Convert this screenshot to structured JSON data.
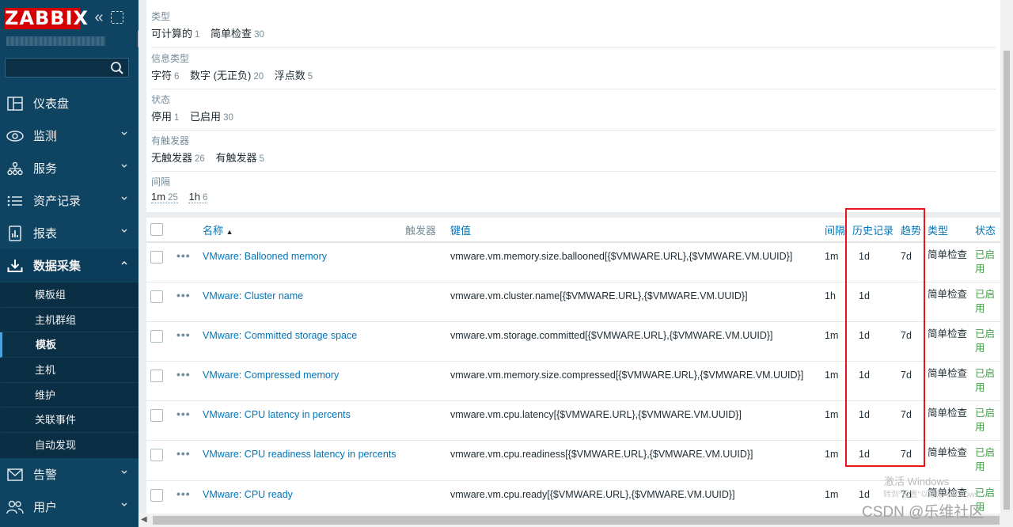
{
  "app": {
    "logo_text": "ZABBIX",
    "search_placeholder": ""
  },
  "sidebar": {
    "items": [
      {
        "label": "仪表盘",
        "icon": "dashboard-icon"
      },
      {
        "label": "监测",
        "icon": "eye-icon"
      },
      {
        "label": "服务",
        "icon": "services-icon"
      },
      {
        "label": "资产记录",
        "icon": "list-icon"
      },
      {
        "label": "报表",
        "icon": "report-icon"
      },
      {
        "label": "数据采集",
        "icon": "download-icon"
      },
      {
        "label": "告警",
        "icon": "mail-icon"
      },
      {
        "label": "用户",
        "icon": "users-icon"
      }
    ],
    "submenu": [
      "模板组",
      "主机群组",
      "模板",
      "主机",
      "维护",
      "关联事件",
      "自动发现"
    ],
    "active_submenu": "模板"
  },
  "filters": [
    {
      "title": "类型",
      "values": [
        {
          "label": "可计算的",
          "count": "1"
        },
        {
          "label": "简单检查",
          "count": "30"
        }
      ]
    },
    {
      "title": "信息类型",
      "values": [
        {
          "label": "字符",
          "count": "6"
        },
        {
          "label": "数字 (无正负)",
          "count": "20"
        },
        {
          "label": "浮点数",
          "count": "5"
        }
      ]
    },
    {
      "title": "状态",
      "values": [
        {
          "label": "停用",
          "count": "1"
        },
        {
          "label": "已启用",
          "count": "30"
        }
      ]
    },
    {
      "title": "有触发器",
      "values": [
        {
          "label": "无触发器",
          "count": "26"
        },
        {
          "label": "有触发器",
          "count": "5"
        }
      ]
    },
    {
      "title": "间隔",
      "values": [
        {
          "label": "1m",
          "count": "25"
        },
        {
          "label": "1h",
          "count": "6"
        }
      ]
    }
  ],
  "table": {
    "headers": {
      "name": "名称",
      "triggers": "触发器",
      "key": "键值",
      "interval": "间隔",
      "history": "历史记录",
      "trends": "趋势",
      "type": "类型",
      "status": "状态"
    },
    "rows": [
      {
        "name": "VMware: Ballooned memory",
        "key": "vmware.vm.memory.size.ballooned[{$VMWARE.URL},{$VMWARE.VM.UUID}]",
        "interval": "1m",
        "history": "1d",
        "trends": "7d",
        "type": "简单检查",
        "status": "已启用"
      },
      {
        "name": "VMware: Cluster name",
        "key": "vmware.vm.cluster.name[{$VMWARE.URL},{$VMWARE.VM.UUID}]",
        "interval": "1h",
        "history": "1d",
        "trends": "",
        "type": "简单检查",
        "status": "已启用"
      },
      {
        "name": "VMware: Committed storage space",
        "key": "vmware.vm.storage.committed[{$VMWARE.URL},{$VMWARE.VM.UUID}]",
        "interval": "1m",
        "history": "1d",
        "trends": "7d",
        "type": "简单检查",
        "status": "已启用"
      },
      {
        "name": "VMware: Compressed memory",
        "key": "vmware.vm.memory.size.compressed[{$VMWARE.URL},{$VMWARE.VM.UUID}]",
        "interval": "1m",
        "history": "1d",
        "trends": "7d",
        "type": "简单检查",
        "status": "已启用"
      },
      {
        "name": "VMware: CPU latency in percents",
        "key": "vmware.vm.cpu.latency[{$VMWARE.URL},{$VMWARE.VM.UUID}]",
        "interval": "1m",
        "history": "1d",
        "trends": "7d",
        "type": "简单检查",
        "status": "已启用"
      },
      {
        "name": "VMware: CPU readiness latency in percents",
        "key": "vmware.vm.cpu.readiness[{$VMWARE.URL},{$VMWARE.VM.UUID}]",
        "interval": "1m",
        "history": "1d",
        "trends": "7d",
        "type": "简单检查",
        "status": "已启用"
      },
      {
        "name": "VMware: CPU ready",
        "key": "vmware.vm.cpu.ready[{$VMWARE.URL},{$VMWARE.VM.UUID}]",
        "interval": "1m",
        "history": "1d",
        "trends": "7d",
        "type": "简单检查",
        "status": "已启用"
      }
    ]
  },
  "watermarks": {
    "activate": "激活 Windows",
    "activate_sub": "转到\"设置\"以激活 Windows。",
    "csdn": "CSDN @乐维社区"
  },
  "colors": {
    "sidebar_bg": "#0e4361",
    "link": "#0275b8",
    "enabled": "#429e47",
    "highlight": "#e6161a",
    "logo": "#d40000"
  }
}
